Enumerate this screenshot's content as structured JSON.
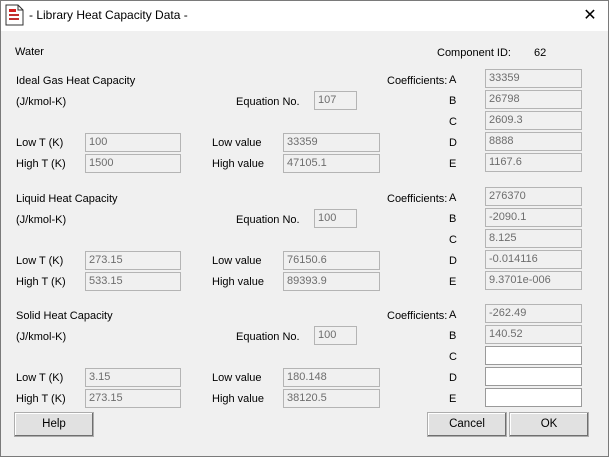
{
  "window": {
    "title": "- Library Heat Capacity Data -",
    "icon": "document-app-icon",
    "close_label": "✕"
  },
  "component": {
    "name": "Water",
    "id_label": "Component ID:",
    "id_value": "62"
  },
  "labels": {
    "coefficients": "Coefficients:",
    "units": "(J/kmol-K)",
    "equation_no": "Equation No.",
    "low_t": "Low T (K)",
    "high_t": "High T (K)",
    "low_value": "Low value",
    "high_value": "High value",
    "coef_letters": [
      "A",
      "B",
      "C",
      "D",
      "E"
    ]
  },
  "sections": [
    {
      "title": "Ideal Gas Heat Capacity",
      "equation_no": "107",
      "low_t": "100",
      "high_t": "1500",
      "low_value": "33359",
      "high_value": "47105.1",
      "coefficients": [
        "33359",
        "26798",
        "2609.3",
        "8888",
        "1167.6"
      ]
    },
    {
      "title": "Liquid Heat Capacity",
      "equation_no": "100",
      "low_t": "273.15",
      "high_t": "533.15",
      "low_value": "76150.6",
      "high_value": "89393.9",
      "coefficients": [
        "276370",
        "-2090.1",
        "8.125",
        "-0.014116",
        "9.3701e-006"
      ]
    },
    {
      "title": "Solid Heat Capacity",
      "equation_no": "100",
      "low_t": "3.15",
      "high_t": "273.15",
      "low_value": "180.148",
      "high_value": "38120.5",
      "coefficients": [
        "-262.49",
        "140.52",
        "",
        "",
        ""
      ]
    }
  ],
  "buttons": {
    "help": "Help",
    "cancel": "Cancel",
    "ok": "OK"
  }
}
